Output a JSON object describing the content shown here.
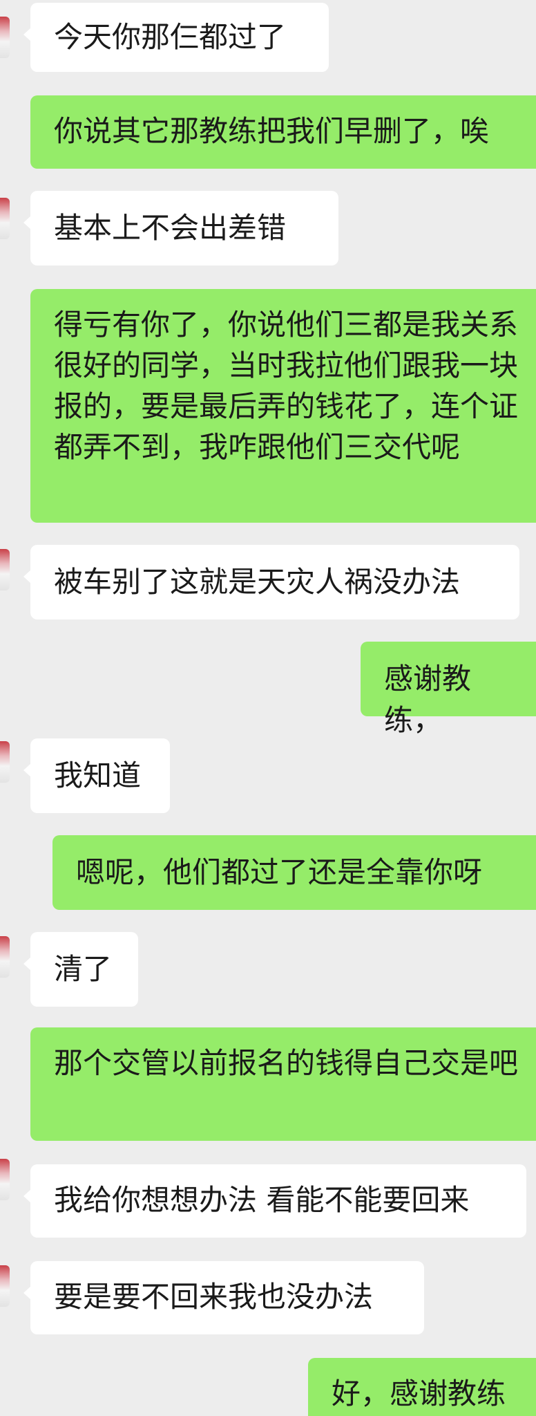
{
  "chat": {
    "background_color": "#ededed",
    "incoming_bubble_color": "#ffffff",
    "outgoing_bubble_color": "#95ec69",
    "messages": [
      {
        "sender": "contact",
        "text": "今天你那仨都过了"
      },
      {
        "sender": "me",
        "text": "你说其它那教练把我们早删了，唉"
      },
      {
        "sender": "contact",
        "text": "基本上不会出差错"
      },
      {
        "sender": "me",
        "text": "得亏有你了，你说他们三都是我关系很好的同学，当时我拉他们跟我一块报的，要是最后弄的钱花了，连个证都弄不到，我咋跟他们三交代呢"
      },
      {
        "sender": "contact",
        "text": "被车别了这就是天灾人祸没办法"
      },
      {
        "sender": "me",
        "text": "感谢教练，"
      },
      {
        "sender": "contact",
        "text": "我知道"
      },
      {
        "sender": "me",
        "text": "嗯呢，他们都过了还是全靠你呀"
      },
      {
        "sender": "contact",
        "text": "清了"
      },
      {
        "sender": "me",
        "text": "那个交管以前报名的钱得自己交是吧"
      },
      {
        "sender": "contact",
        "text": "我给你想想办法 看能不能要回来"
      },
      {
        "sender": "contact",
        "text": "要是要不回来我也没办法"
      },
      {
        "sender": "me",
        "text": "好，感谢教练"
      }
    ]
  }
}
